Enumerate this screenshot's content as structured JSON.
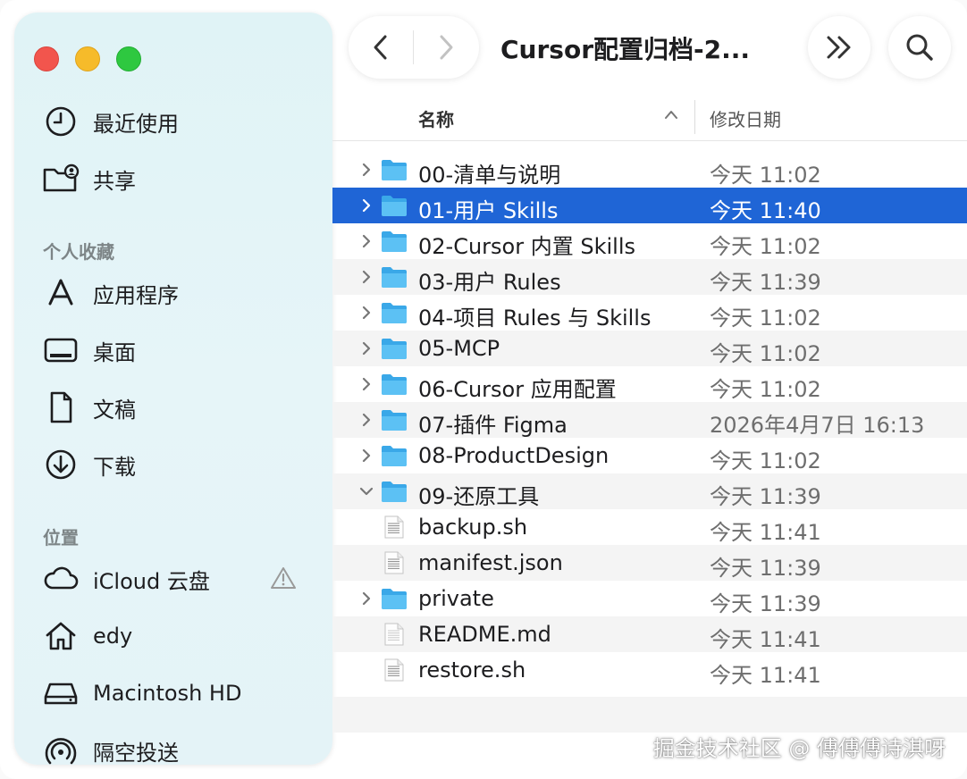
{
  "window": {
    "title": "Cursor配置归档-2...",
    "accent": "#1f65d6"
  },
  "sidebar": {
    "top_items": [
      {
        "label": "最近使用",
        "icon": "clock-icon"
      },
      {
        "label": "共享",
        "icon": "shared-folder-icon"
      }
    ],
    "favorites_heading": "个人收藏",
    "favorites": [
      {
        "label": "应用程序",
        "icon": "applications-icon"
      },
      {
        "label": "桌面",
        "icon": "desktop-icon"
      },
      {
        "label": "文稿",
        "icon": "document-icon"
      },
      {
        "label": "下载",
        "icon": "download-icon"
      }
    ],
    "locations_heading": "位置",
    "locations": [
      {
        "label": "iCloud 云盘",
        "icon": "cloud-icon"
      },
      {
        "label": "edy",
        "icon": "home-icon"
      },
      {
        "label": "Macintosh HD",
        "icon": "drive-icon"
      },
      {
        "label": "隔空投送",
        "icon": "airdrop-icon"
      }
    ]
  },
  "columns": {
    "name": "名称",
    "date": "修改日期"
  },
  "files": [
    {
      "name": "00-清单与说明",
      "date": "今天 11:02",
      "kind": "folder",
      "expand": "collapsed"
    },
    {
      "name": "01-用户 Skills",
      "date": "今天 11:40",
      "kind": "folder",
      "expand": "collapsed",
      "selected": true
    },
    {
      "name": "02-Cursor 内置 Skills",
      "date": "今天 11:02",
      "kind": "folder",
      "expand": "collapsed"
    },
    {
      "name": "03-用户 Rules",
      "date": "今天 11:39",
      "kind": "folder",
      "expand": "collapsed"
    },
    {
      "name": "04-项目 Rules 与 Skills",
      "date": "今天 11:02",
      "kind": "folder",
      "expand": "collapsed"
    },
    {
      "name": "05-MCP",
      "date": "今天 11:02",
      "kind": "folder",
      "expand": "collapsed"
    },
    {
      "name": "06-Cursor 应用配置",
      "date": "今天 11:02",
      "kind": "folder",
      "expand": "collapsed"
    },
    {
      "name": "07-插件 Figma",
      "date": "2026年4月7日 16:13",
      "kind": "folder",
      "expand": "collapsed"
    },
    {
      "name": "08-ProductDesign",
      "date": "今天 11:02",
      "kind": "folder",
      "expand": "collapsed"
    },
    {
      "name": "09-还原工具",
      "date": "今天 11:39",
      "kind": "folder",
      "expand": "expanded"
    },
    {
      "name": "backup.sh",
      "date": "今天 11:41",
      "kind": "script",
      "expand": "none"
    },
    {
      "name": "manifest.json",
      "date": "今天 11:39",
      "kind": "script",
      "expand": "none"
    },
    {
      "name": "private",
      "date": "今天 11:39",
      "kind": "folder",
      "expand": "collapsed"
    },
    {
      "name": "README.md",
      "date": "今天 11:41",
      "kind": "text",
      "expand": "none"
    },
    {
      "name": "restore.sh",
      "date": "今天 11:41",
      "kind": "script",
      "expand": "none"
    }
  ],
  "watermark": "掘金技术社区 @ 傅傅傅诗淇呀"
}
